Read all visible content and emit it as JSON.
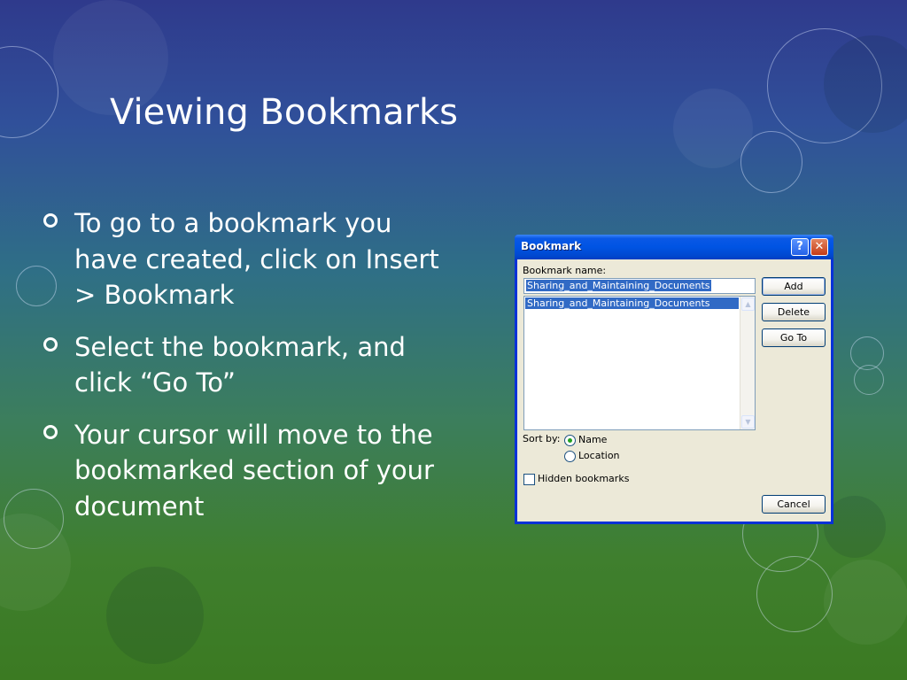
{
  "slide": {
    "title": "Viewing Bookmarks",
    "bullets": [
      "To go to a bookmark you have created, click on Insert > Bookmark",
      "Select the bookmark, and click “Go To”",
      "Your cursor will move to the bookmarked section of your document"
    ]
  },
  "dialog": {
    "title": "Bookmark",
    "help_glyph": "?",
    "close_glyph": "✕",
    "bookmark_name_label": "Bookmark name:",
    "bookmark_name_value": "Sharing_and_Maintaining_Documents",
    "list_items": [
      "Sharing_and_Maintaining_Documents"
    ],
    "buttons": {
      "add": "Add",
      "delete": "Delete",
      "goto": "Go To",
      "cancel": "Cancel"
    },
    "sort_by_label": "Sort by:",
    "sort_options": [
      "Name",
      "Location"
    ],
    "sort_selected": "Name",
    "hidden_bookmarks_label": "Hidden bookmarks",
    "hidden_bookmarks_checked": false,
    "scroll_up_glyph": "▲",
    "scroll_down_glyph": "▼"
  },
  "colors": {
    "titlebar": "#0054e3",
    "selection": "#316ac5",
    "dialog_face": "#ece9d8"
  }
}
